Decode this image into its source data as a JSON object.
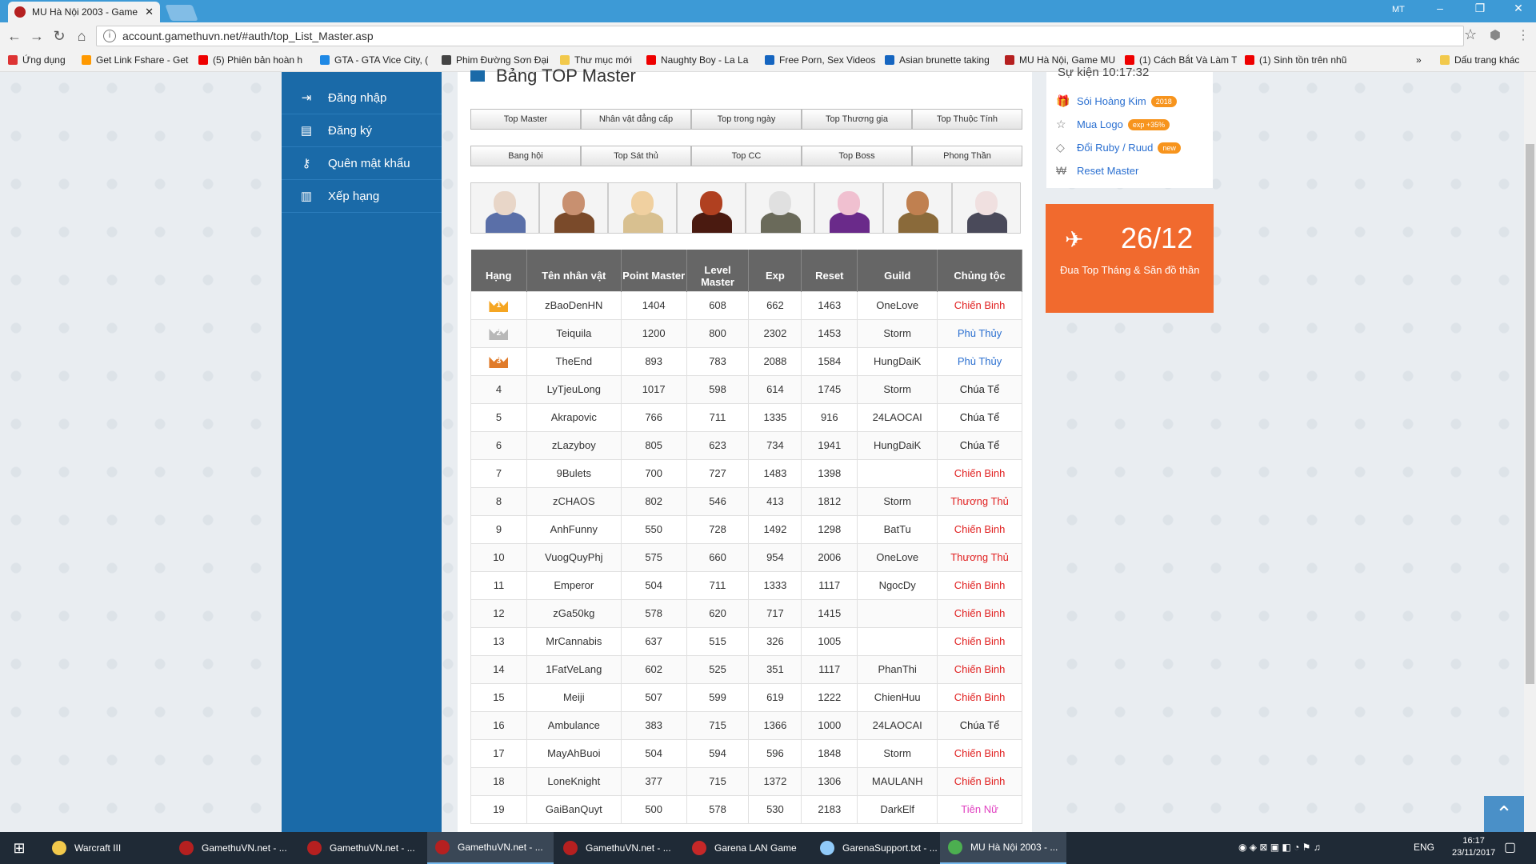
{
  "browser": {
    "tab_title": "MU Hà Nội 2003 - Game",
    "tab_close": "✕",
    "user": "MT",
    "url": "account.gamethuvn.net/#auth/top_List_Master.asp",
    "bookmarks": [
      {
        "label": "Ứng dụng",
        "color": "#d33"
      },
      {
        "label": "Get Link Fshare - Get",
        "color": "#f90"
      },
      {
        "label": "(5) Phiên bản hoàn h",
        "color": "#e00"
      },
      {
        "label": "GTA - GTA Vice City, (",
        "color": "#1e88e5"
      },
      {
        "label": "Phim Đường Sơn Đại",
        "color": "#444"
      },
      {
        "label": "Thư mục mới",
        "color": "#f2c94c"
      },
      {
        "label": "Naughty Boy - La La",
        "color": "#e00"
      },
      {
        "label": "Free Porn, Sex Videos",
        "color": "#1565c0"
      },
      {
        "label": "Asian brunette taking",
        "color": "#1565c0"
      },
      {
        "label": "MU Hà Nội, Game MU",
        "color": "#b52020"
      },
      {
        "label": "(1) Cách Bắt Và Làm T",
        "color": "#e00"
      },
      {
        "label": "(1) Sinh tồn trên nhũ",
        "color": "#e00"
      }
    ],
    "more": "»",
    "other_bookmarks": "Dấu trang khác"
  },
  "sidebar": {
    "items": [
      {
        "label": "Đăng nhập",
        "icon": "login-icon"
      },
      {
        "label": "Đăng ký",
        "icon": "document-icon"
      },
      {
        "label": "Quên mật khẩu",
        "icon": "key-icon"
      },
      {
        "label": "Xếp hạng",
        "icon": "bar-chart-icon"
      }
    ]
  },
  "main": {
    "title": "Bảng TOP Master",
    "tabs_row1": [
      "Top Master",
      "Nhân vật đẳng cấp",
      "Top trong ngày",
      "Top Thương gia",
      "Top Thuộc Tính"
    ],
    "tabs_row2": [
      "Bang hội",
      "Top Sát thủ",
      "Top CC",
      "Top Boss",
      "Phong Thần"
    ],
    "character_classes": [
      "Blade Knight",
      "Dark Wizard",
      "Elf",
      "Magic Gladiator",
      "Dark Lord",
      "Summoner",
      "Rage Fighter",
      "Grow Lancer"
    ],
    "table": {
      "headers": [
        "Hạng",
        "Tên nhân vật",
        "Point Master",
        "Level Master",
        "Exp",
        "Reset",
        "Guild",
        "Chủng tộc"
      ],
      "rows": [
        {
          "rank": "1",
          "name": "zBaoDenHN",
          "pm": "1404",
          "lm": "608",
          "exp": "662",
          "reset": "1463",
          "guild": "OneLove",
          "race": "Chiến Binh",
          "rc": "red",
          "crown": "#f5a623"
        },
        {
          "rank": "2",
          "name": "Teiquila",
          "pm": "1200",
          "lm": "800",
          "exp": "2302",
          "reset": "1453",
          "guild": "Storm",
          "race": "Phù Thủy",
          "rc": "blue",
          "crown": "#b8b8b8"
        },
        {
          "rank": "3",
          "name": "TheEnd",
          "pm": "893",
          "lm": "783",
          "exp": "2088",
          "reset": "1584",
          "guild": "HungDaiK",
          "race": "Phù Thủy",
          "rc": "blue",
          "crown": "#e07b2a"
        },
        {
          "rank": "4",
          "name": "LyTjeuLong",
          "pm": "1017",
          "lm": "598",
          "exp": "614",
          "reset": "1745",
          "guild": "Storm",
          "race": "Chúa Tể",
          "rc": "black"
        },
        {
          "rank": "5",
          "name": "Akrapovic",
          "pm": "766",
          "lm": "711",
          "exp": "1335",
          "reset": "916",
          "guild": "24LAOCAI",
          "race": "Chúa Tể",
          "rc": "black"
        },
        {
          "rank": "6",
          "name": "zLazyboy",
          "pm": "805",
          "lm": "623",
          "exp": "734",
          "reset": "1941",
          "guild": "HungDaiK",
          "race": "Chúa Tể",
          "rc": "black"
        },
        {
          "rank": "7",
          "name": "9Bulets",
          "pm": "700",
          "lm": "727",
          "exp": "1483",
          "reset": "1398",
          "guild": "",
          "race": "Chiến Binh",
          "rc": "red"
        },
        {
          "rank": "8",
          "name": "zCHAOS",
          "pm": "802",
          "lm": "546",
          "exp": "413",
          "reset": "1812",
          "guild": "Storm",
          "race": "Thương Thủ",
          "rc": "red"
        },
        {
          "rank": "9",
          "name": "AnhFunny",
          "pm": "550",
          "lm": "728",
          "exp": "1492",
          "reset": "1298",
          "guild": "BatTu",
          "race": "Chiến Binh",
          "rc": "red"
        },
        {
          "rank": "10",
          "name": "VuogQuyPhj",
          "pm": "575",
          "lm": "660",
          "exp": "954",
          "reset": "2006",
          "guild": "OneLove",
          "race": "Thương Thủ",
          "rc": "red"
        },
        {
          "rank": "11",
          "name": "Emperor",
          "pm": "504",
          "lm": "711",
          "exp": "1333",
          "reset": "1117",
          "guild": "NgocDy",
          "race": "Chiến Binh",
          "rc": "red"
        },
        {
          "rank": "12",
          "name": "zGa50kg",
          "pm": "578",
          "lm": "620",
          "exp": "717",
          "reset": "1415",
          "guild": "",
          "race": "Chiến Binh",
          "rc": "red"
        },
        {
          "rank": "13",
          "name": "MrCannabis",
          "pm": "637",
          "lm": "515",
          "exp": "326",
          "reset": "1005",
          "guild": "",
          "race": "Chiến Binh",
          "rc": "red"
        },
        {
          "rank": "14",
          "name": "1FatVeLang",
          "pm": "602",
          "lm": "525",
          "exp": "351",
          "reset": "1117",
          "guild": "PhanThi",
          "race": "Chiến Binh",
          "rc": "red"
        },
        {
          "rank": "15",
          "name": "Meiji",
          "pm": "507",
          "lm": "599",
          "exp": "619",
          "reset": "1222",
          "guild": "ChienHuu",
          "race": "Chiến Binh",
          "rc": "red"
        },
        {
          "rank": "16",
          "name": "Ambulance",
          "pm": "383",
          "lm": "715",
          "exp": "1366",
          "reset": "1000",
          "guild": "24LAOCAI",
          "race": "Chúa Tể",
          "rc": "black"
        },
        {
          "rank": "17",
          "name": "MayAhBuoi",
          "pm": "504",
          "lm": "594",
          "exp": "596",
          "reset": "1848",
          "guild": "Storm",
          "race": "Chiến Binh",
          "rc": "red"
        },
        {
          "rank": "18",
          "name": "LoneKnight",
          "pm": "377",
          "lm": "715",
          "exp": "1372",
          "reset": "1306",
          "guild": "MAULANH",
          "race": "Chiến Binh",
          "rc": "red"
        },
        {
          "rank": "19",
          "name": "GaiBanQuyt",
          "pm": "500",
          "lm": "578",
          "exp": "530",
          "reset": "2183",
          "guild": "DarkElf",
          "race": "Tiên Nữ",
          "rc": "pink"
        }
      ]
    }
  },
  "right": {
    "event_partial": "Sự kiện 10:17:32",
    "links": [
      {
        "label": "Sói Hoàng Kim",
        "badge": "2018",
        "icon": "gift-icon"
      },
      {
        "label": "Mua Logo",
        "badge": "exp +35%",
        "icon": "star-icon"
      },
      {
        "label": "Đổi Ruby / Ruud",
        "badge": "new",
        "icon": "diamond-icon"
      },
      {
        "label": "Reset Master",
        "badge": "",
        "icon": "won-icon"
      }
    ],
    "event": {
      "date": "26/12",
      "text": "Đua Top Tháng & Săn đồ thần"
    }
  },
  "taskbar": {
    "items": [
      {
        "label": "Warcraft III",
        "color": "#f2c94c"
      },
      {
        "label": "GamethuVN.net - ...",
        "color": "#b52020"
      },
      {
        "label": "GamethuVN.net - ...",
        "color": "#b52020"
      },
      {
        "label": "GamethuVN.net - ...",
        "color": "#b52020"
      },
      {
        "label": "GamethuVN.net - ...",
        "color": "#b52020"
      },
      {
        "label": "Garena LAN Game",
        "color": "#c62828"
      },
      {
        "label": "GarenaSupport.txt - ...",
        "color": "#90caf9"
      },
      {
        "label": "MU Hà Nội 2003 - ...",
        "color": "#4caf50"
      }
    ],
    "lang": "ENG",
    "time": "16:17",
    "date": "23/11/2017"
  },
  "colors": {
    "sidebar": "#1a6aa8",
    "event": "#f16a2e",
    "header": "#666666"
  }
}
